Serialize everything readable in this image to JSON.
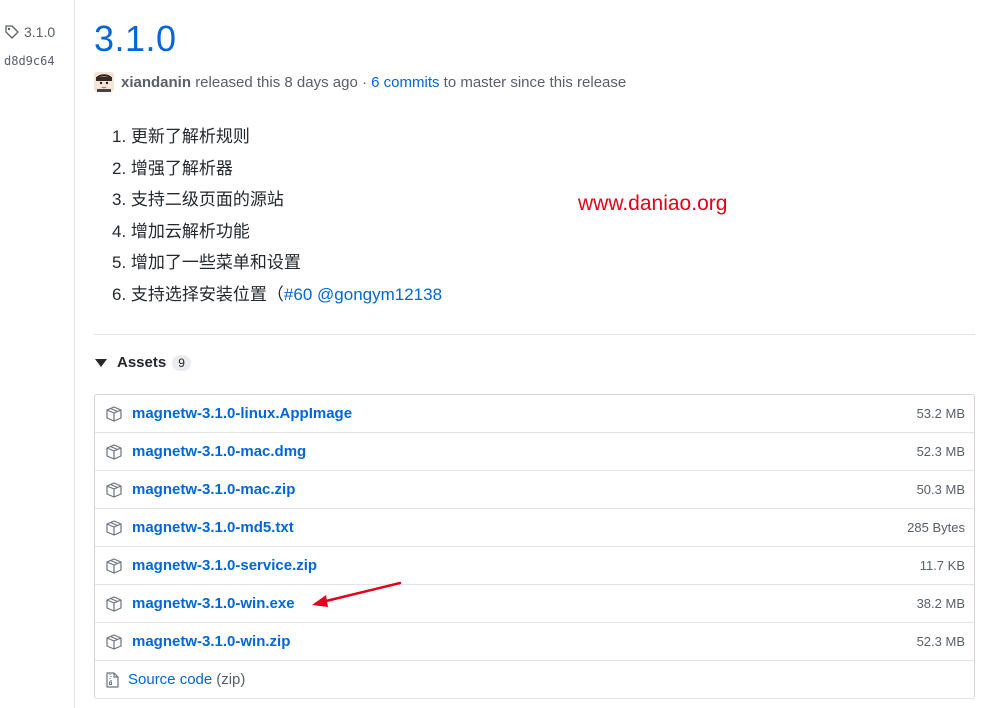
{
  "sidebar": {
    "tag_label": "3.1.0",
    "commit_sha": "d8d9c64"
  },
  "release": {
    "title": "3.1.0",
    "author": "xiandanin",
    "released_text": "released this 8 days ago ·",
    "commits_link": "6 commits",
    "branch_text": "to master since this release"
  },
  "notes": [
    {
      "num": "1.",
      "text": "更新了解析规则"
    },
    {
      "num": "2.",
      "text": "增强了解析器"
    },
    {
      "num": "3.",
      "text": "支持二级页面的源站"
    },
    {
      "num": "4.",
      "text": "增加云解析功能"
    },
    {
      "num": "5.",
      "text": "增加了一些菜单和设置"
    },
    {
      "num": "6.",
      "text": "支持选择安装位置（",
      "issue_link": "#60",
      "user_link": "@gongym12138"
    }
  ],
  "watermark": "www.daniao.org",
  "assets": {
    "heading": "Assets",
    "count": "9",
    "files": [
      {
        "name": "magnetw-3.1.0-linux.AppImage",
        "size": "53.2 MB"
      },
      {
        "name": "magnetw-3.1.0-mac.dmg",
        "size": "52.3 MB"
      },
      {
        "name": "magnetw-3.1.0-mac.zip",
        "size": "50.3 MB"
      },
      {
        "name": "magnetw-3.1.0-md5.txt",
        "size": "285 Bytes"
      },
      {
        "name": "magnetw-3.1.0-service.zip",
        "size": "11.7 KB"
      },
      {
        "name": "magnetw-3.1.0-win.exe",
        "size": "38.2 MB"
      },
      {
        "name": "magnetw-3.1.0-win.zip",
        "size": "52.3 MB"
      }
    ],
    "source": {
      "label": "Source code",
      "format": "(zip)"
    }
  },
  "colors": {
    "link": "#0366d6",
    "annotation": "#e3001b",
    "text_muted": "#586069"
  },
  "icons": [
    "tag-icon",
    "package-icon",
    "file-zip-icon",
    "triangle-down-icon",
    "red-arrow-annotation"
  ]
}
